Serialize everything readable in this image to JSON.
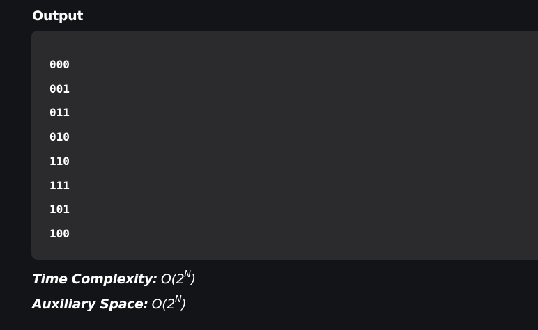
{
  "section": {
    "title": "Output"
  },
  "output": {
    "lines": [
      "000",
      "001",
      "011",
      "010",
      "110",
      "111",
      "101",
      "100"
    ]
  },
  "complexity": {
    "time": {
      "label": "Time Complexity:",
      "prefix": "O(2",
      "exponent": "N",
      "suffix": ")"
    },
    "space": {
      "label": "Auxiliary Space:",
      "prefix": "O(2",
      "exponent": "N",
      "suffix": ")"
    }
  },
  "colors": {
    "page_background": "#131417",
    "output_background": "#2b2b2d",
    "text": "#ffffff"
  }
}
